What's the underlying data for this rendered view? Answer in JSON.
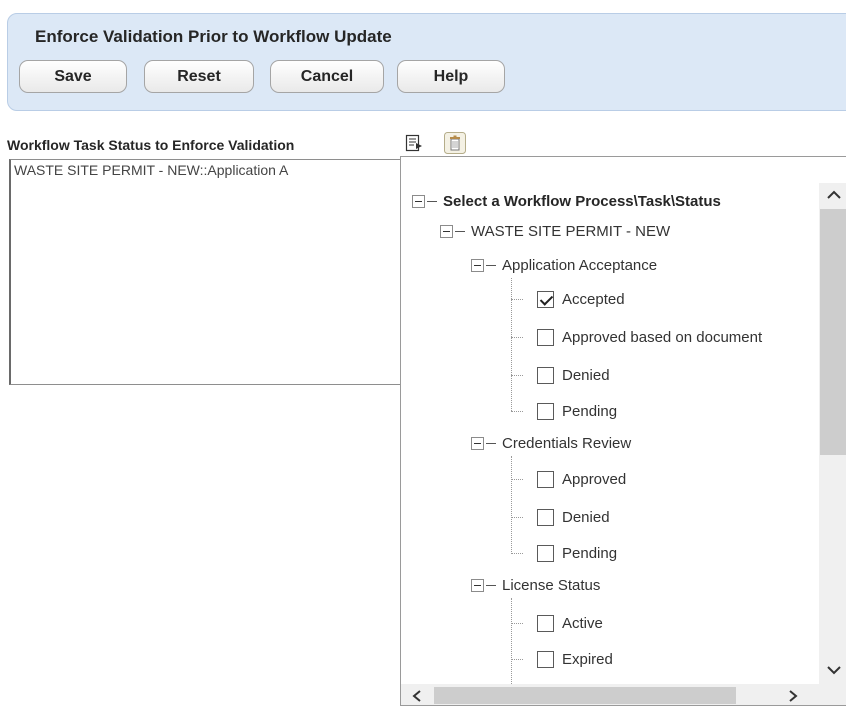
{
  "header": {
    "title": "Enforce Validation Prior to Workflow Update",
    "buttons": {
      "save": "Save",
      "reset": "Reset",
      "cancel": "Cancel",
      "help": "Help"
    }
  },
  "field": {
    "label": "Workflow Task Status to Enforce Validation",
    "value": "WASTE SITE PERMIT - NEW::Application A",
    "icons": [
      "select-list-icon",
      "trash-icon"
    ]
  },
  "tree": {
    "root": "Select a Workflow Process\\Task\\Status",
    "process": "WASTE SITE PERMIT - NEW",
    "tasks": [
      {
        "name": "Application Acceptance",
        "statuses": [
          {
            "label": "Accepted",
            "checked": true
          },
          {
            "label": "Approved based on document",
            "checked": false
          },
          {
            "label": "Denied",
            "checked": false
          },
          {
            "label": "Pending",
            "checked": false
          }
        ]
      },
      {
        "name": "Credentials Review",
        "statuses": [
          {
            "label": "Approved",
            "checked": false
          },
          {
            "label": "Denied",
            "checked": false
          },
          {
            "label": "Pending",
            "checked": false
          }
        ]
      },
      {
        "name": "License Status",
        "statuses": [
          {
            "label": "Active",
            "checked": false
          },
          {
            "label": "Expired",
            "checked": false
          }
        ]
      }
    ]
  },
  "icons": {
    "close": "close-icon",
    "scroll_up": "chevron-up-icon",
    "scroll_down": "chevron-down-icon",
    "scroll_left": "chevron-left-icon",
    "scroll_right": "chevron-right-icon"
  }
}
